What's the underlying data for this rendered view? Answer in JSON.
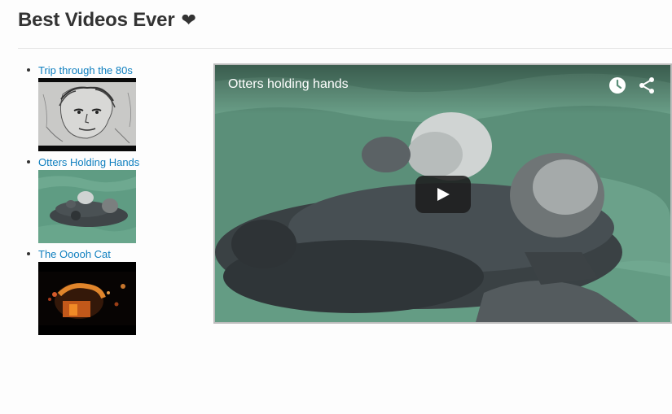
{
  "page": {
    "title": "Best Videos Ever",
    "title_icon": "heart-icon",
    "title_icon_glyph": "❤"
  },
  "videos": [
    {
      "label": "Trip through the 80s",
      "thumb": "sketch-boy-thumbnail"
    },
    {
      "label": "Otters Holding Hands",
      "thumb": "otters-thumbnail"
    },
    {
      "label": "The Ooooh Cat",
      "thumb": "dark-cat-thumbnail"
    }
  ],
  "player": {
    "video_title": "Otters holding hands",
    "watch_later_icon": "clock-icon",
    "share_icon": "share-icon",
    "play_icon": "play-icon"
  },
  "colors": {
    "link": "#0f7fbf",
    "heading": "#333333",
    "water": "#5a8d77"
  }
}
